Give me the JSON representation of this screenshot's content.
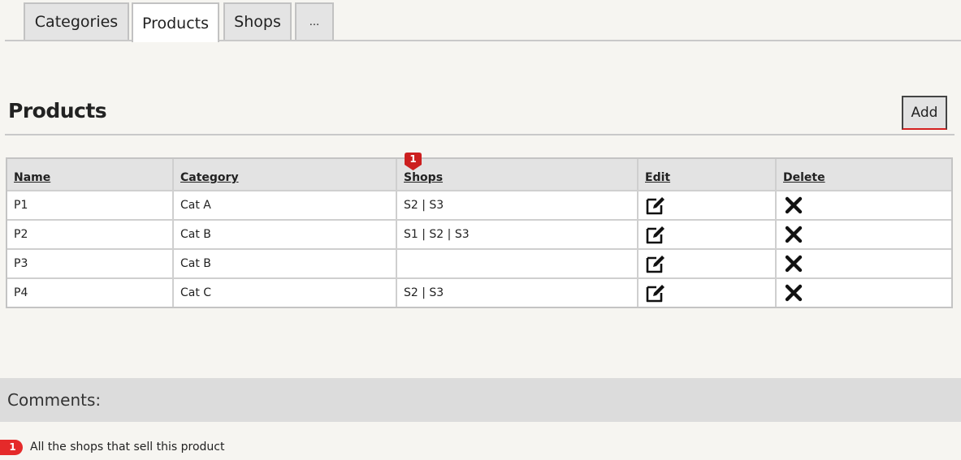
{
  "tabs": [
    {
      "label": "Categories",
      "active": false
    },
    {
      "label": "Products",
      "active": true
    },
    {
      "label": "Shops",
      "active": false
    },
    {
      "label": "...",
      "active": false
    }
  ],
  "page": {
    "title": "Products",
    "add_label": "Add"
  },
  "table": {
    "headers": [
      "Name",
      "Category",
      "Shops",
      "Edit",
      "Delete"
    ],
    "rows": [
      {
        "name": "P1",
        "category": "Cat A",
        "shops": "S2 | S3"
      },
      {
        "name": "P2",
        "category": "Cat B",
        "shops": "S1 | S2 | S3"
      },
      {
        "name": "P3",
        "category": "Cat B",
        "shops": ""
      },
      {
        "name": "P4",
        "category": "Cat C",
        "shops": "S2 | S3"
      }
    ],
    "row_icons": {
      "edit": "edit-icon",
      "delete": "delete-icon"
    }
  },
  "marker": {
    "number": "1",
    "color": "#cc1f1f"
  },
  "comments": {
    "title": "Comments:",
    "items": [
      {
        "number": "1",
        "text": "All the shops that sell this product",
        "color": "#e52a2a"
      }
    ]
  }
}
